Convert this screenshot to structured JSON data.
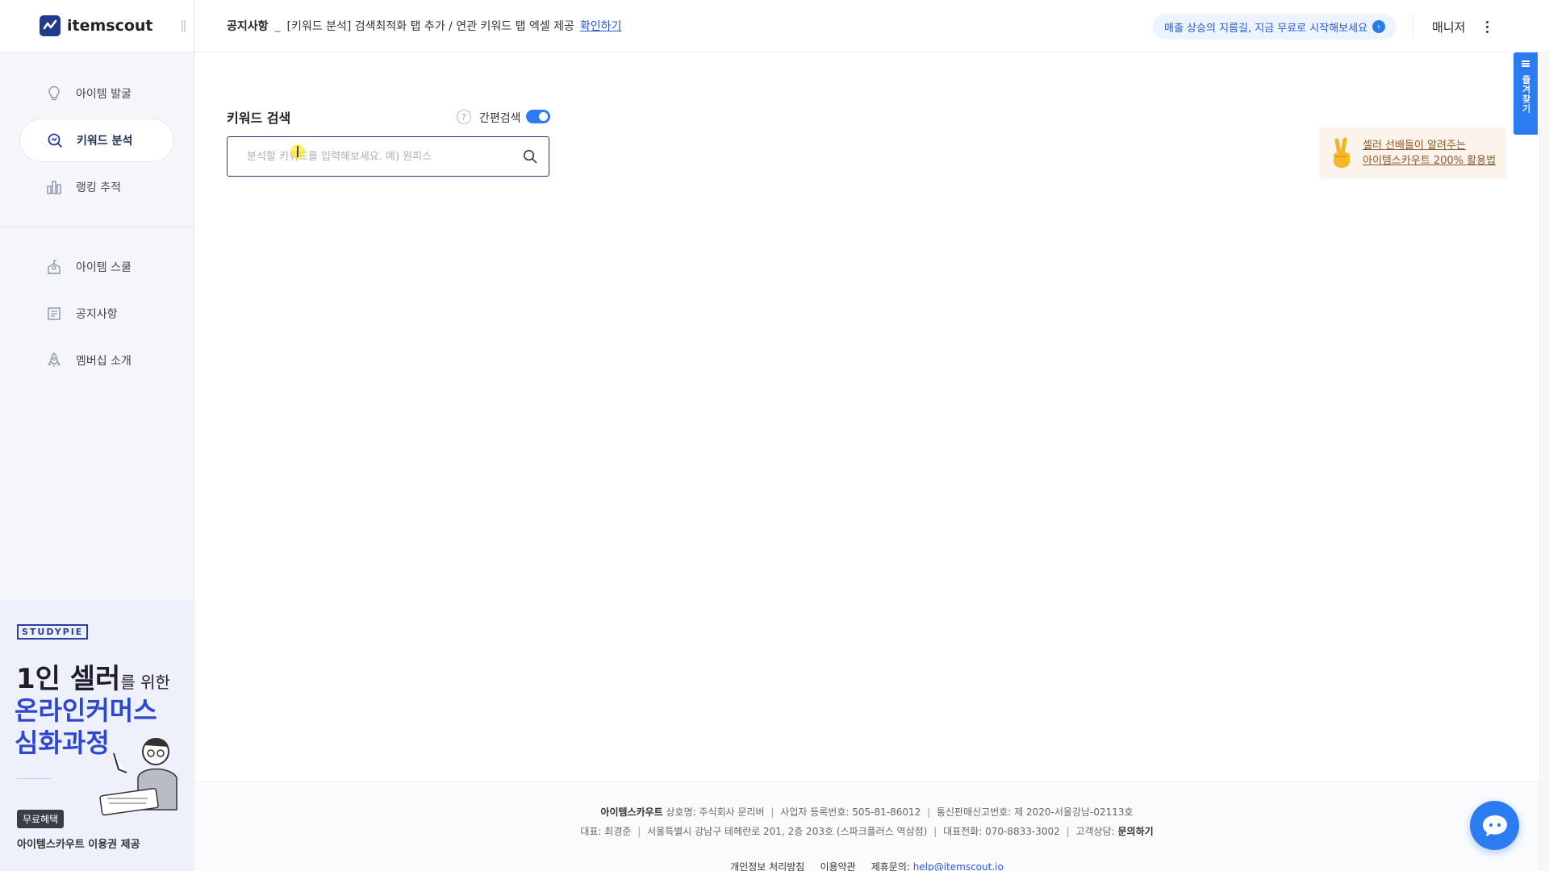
{
  "app": {
    "logo_text": "itemscout"
  },
  "sidebar": {
    "items": [
      {
        "label": "아이템 발굴",
        "icon": "lightbulb-icon"
      },
      {
        "label": "키워드 분석",
        "icon": "keyword-search-icon",
        "active": true
      },
      {
        "label": "랭킹 추적",
        "icon": "bar-chart-icon"
      }
    ],
    "items2": [
      {
        "label": "아이템 스쿨",
        "icon": "school-icon"
      },
      {
        "label": "공지사항",
        "icon": "notice-icon"
      },
      {
        "label": "멤버십 소개",
        "icon": "rocket-icon"
      }
    ]
  },
  "promo": {
    "brand": "STUDYPIE",
    "line1_big": "1인 셀러",
    "line1_small": "를 위한",
    "line2": "온라인커머스",
    "line3": "심화과정",
    "badge": "무료혜택",
    "sub": "아이템스카우트 이용권 제공"
  },
  "header": {
    "notice_label": "공지사항",
    "notice_sep": "_",
    "notice_text": "[키워드 분석] 검색최적화 탭 추가 / 연관 키워드 탭 엑셀 제공",
    "notice_link": "확인하기",
    "cta": "매출 상승의 지름길, 지금 무료로 시작해보세요",
    "user": "매니저"
  },
  "search": {
    "title": "키워드 검색",
    "help": "?",
    "quick_label": "간편검색",
    "quick_enabled": true,
    "placeholder": "분석할 키워드를 입력해보세요. 예) 원피스",
    "value": ""
  },
  "tip": {
    "line1": "셀러 선배들이 알려주는",
    "line2": "아이템스카우트 200% 활용법"
  },
  "side_tab": {
    "label": "즐겨찾기"
  },
  "footer": {
    "company": "아이템스카우트",
    "company_name": "상호명: 주식회사 문리버",
    "biz_no": "사업자 등록번호: 505-81-86012",
    "ecommerce_no": "통신판매신고번호: 제 2020-서울강남-02113호",
    "ceo": "대표: 최경준",
    "address": "서울특별시 강남구 테헤란로 201, 2층 203호 (스파크플러스 역삼점)",
    "phone": "대표전화: 070-8833-3002",
    "support_label": "고객상담:",
    "support_link": "문의하기",
    "privacy": "개인정보 처리방침",
    "terms": "이용약관",
    "partner_label": "제휴문의:",
    "partner_email": "help@itemscout.io"
  },
  "colors": {
    "accent": "#2a7cf0",
    "brand_dark": "#1f3a8f",
    "promo_blue": "#2e47d0"
  }
}
